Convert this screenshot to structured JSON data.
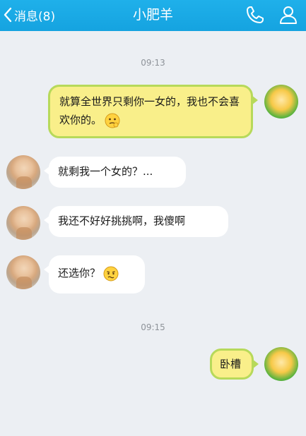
{
  "header": {
    "back_label": "消息(8)",
    "title": "小肥羊",
    "icons": [
      "chevron-left-icon",
      "phone-icon",
      "contact-icon"
    ]
  },
  "messages": [
    {
      "type": "timestamp",
      "text": "09:13"
    },
    {
      "type": "outgoing",
      "text": "就算全世界只剩你一女的，我也不会喜欢你的。",
      "emoji": "thinking-emoji"
    },
    {
      "type": "incoming",
      "text": "就剩我一个女的？..."
    },
    {
      "type": "incoming",
      "text": "我还不好好挑挑啊，我傻啊"
    },
    {
      "type": "incoming",
      "text": "还选你？",
      "emoji": "awkward-emoji"
    },
    {
      "type": "timestamp",
      "text": "09:15"
    },
    {
      "type": "outgoing",
      "text": "卧槽"
    }
  ],
  "colors": {
    "topbar": "#1aaae6",
    "background": "#eceff3",
    "outgoing_bubble": "#f9ef8a",
    "outgoing_border": "#b7d95a",
    "incoming_bubble": "#ffffff"
  }
}
